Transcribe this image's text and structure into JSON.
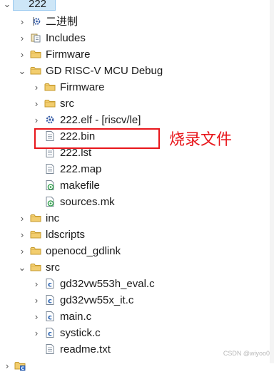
{
  "tree": {
    "root": {
      "label": "222"
    },
    "binaries": {
      "label": "二进制"
    },
    "includes": {
      "label": "Includes"
    },
    "firmware": {
      "label": "Firmware"
    },
    "debug_folder": {
      "label": "GD RISC-V MCU Debug"
    },
    "debug_firmware": {
      "label": "Firmware"
    },
    "debug_src": {
      "label": "src"
    },
    "elf": {
      "label": "222.elf - [riscv/le]"
    },
    "bin": {
      "label": "222.bin"
    },
    "lst": {
      "label": "222.lst"
    },
    "map": {
      "label": "222.map"
    },
    "makefile": {
      "label": "makefile"
    },
    "sources": {
      "label": "sources.mk"
    },
    "inc": {
      "label": "inc"
    },
    "ldscripts": {
      "label": "ldscripts"
    },
    "openocd": {
      "label": "openocd_gdlink"
    },
    "src": {
      "label": "src"
    },
    "file_eval": {
      "label": "gd32vw553h_eval.c"
    },
    "file_it": {
      "label": "gd32vw55x_it.c"
    },
    "file_main": {
      "label": "main.c"
    },
    "file_systick": {
      "label": "systick.c"
    },
    "file_readme": {
      "label": "readme.txt"
    }
  },
  "annotation": {
    "text": "烧录文件",
    "color": "#e8161b"
  },
  "watermark": {
    "text": "CSDN @wiyoo0"
  },
  "colors": {
    "folder": "#e8b84a",
    "selection": "#cde6f7",
    "c_file": "#2a62b0",
    "makefile_badge": "#2e9e4a"
  }
}
